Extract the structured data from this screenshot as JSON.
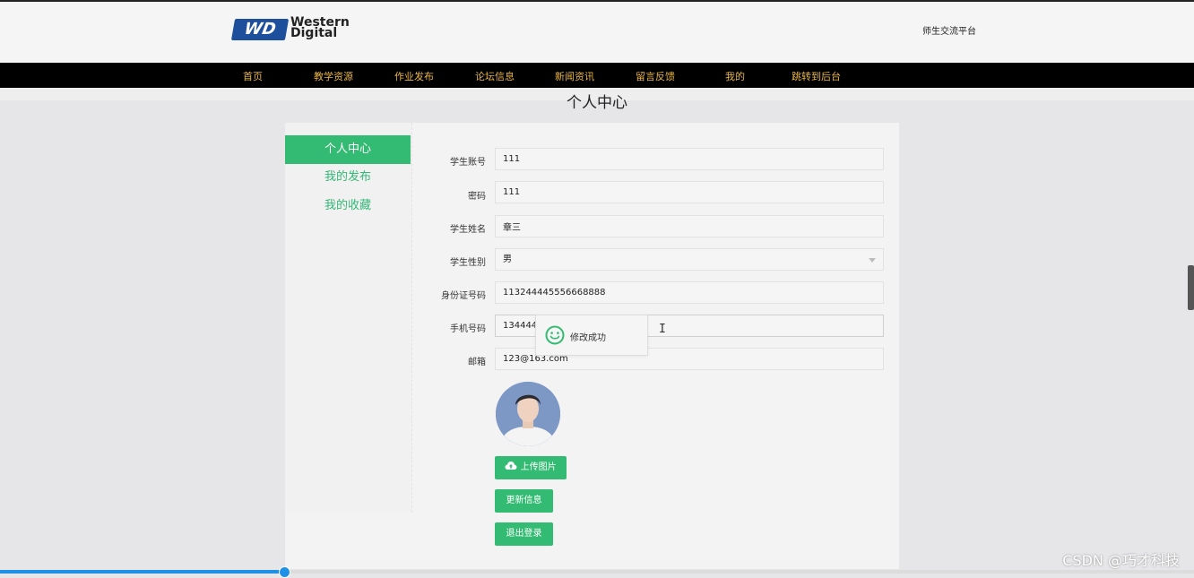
{
  "header": {
    "logo_mark": "WD",
    "logo_line1": "Western",
    "logo_line2": "Digital",
    "site_title": "师生交流平台"
  },
  "nav": [
    "首页",
    "教学资源",
    "作业发布",
    "论坛信息",
    "新闻资讯",
    "留言反馈",
    "我的",
    "跳转到后台"
  ],
  "page": {
    "title": "个人中心"
  },
  "sidebar": {
    "items": [
      {
        "label": "个人中心",
        "active": true
      },
      {
        "label": "我的发布",
        "active": false
      },
      {
        "label": "我的收藏",
        "active": false
      }
    ]
  },
  "form": {
    "account_label": "学生账号",
    "account_value": "111",
    "password_label": "密码",
    "password_value": "111",
    "name_label": "学生姓名",
    "name_value": "章三",
    "gender_label": "学生性别",
    "gender_value": "男",
    "id_label": "身份证号码",
    "id_value": "113244445556668888",
    "phone_label": "手机号码",
    "phone_value": "1344444",
    "email_label": "邮箱",
    "email_value": "123@163.com"
  },
  "buttons": {
    "upload": "上传图片",
    "update": "更新信息",
    "logout": "退出登录"
  },
  "toast": {
    "message": "修改成功"
  },
  "progress": {
    "fraction": 0.238
  },
  "watermark": "CSDN @巧才科技",
  "colors": {
    "accent": "#33bb73",
    "nav_bg": "#000000",
    "nav_text": "#e7b544",
    "progress": "#1e90e6"
  }
}
